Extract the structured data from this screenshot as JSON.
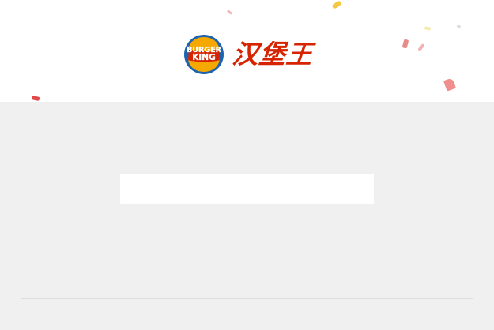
{
  "header": {
    "logo_text": "BURGER KING",
    "brand_name_cn": "汉堡王",
    "logo_icon": "burger-king-logo-icon"
  },
  "main": {
    "status_text": ""
  },
  "colors": {
    "brand_red": "#d62300",
    "brand_orange": "#ff8732",
    "bun_yellow": "#f5a800",
    "logo_blue": "#1e63b0",
    "page_background": "#f0f0f0",
    "header_background": "#ffffff"
  }
}
